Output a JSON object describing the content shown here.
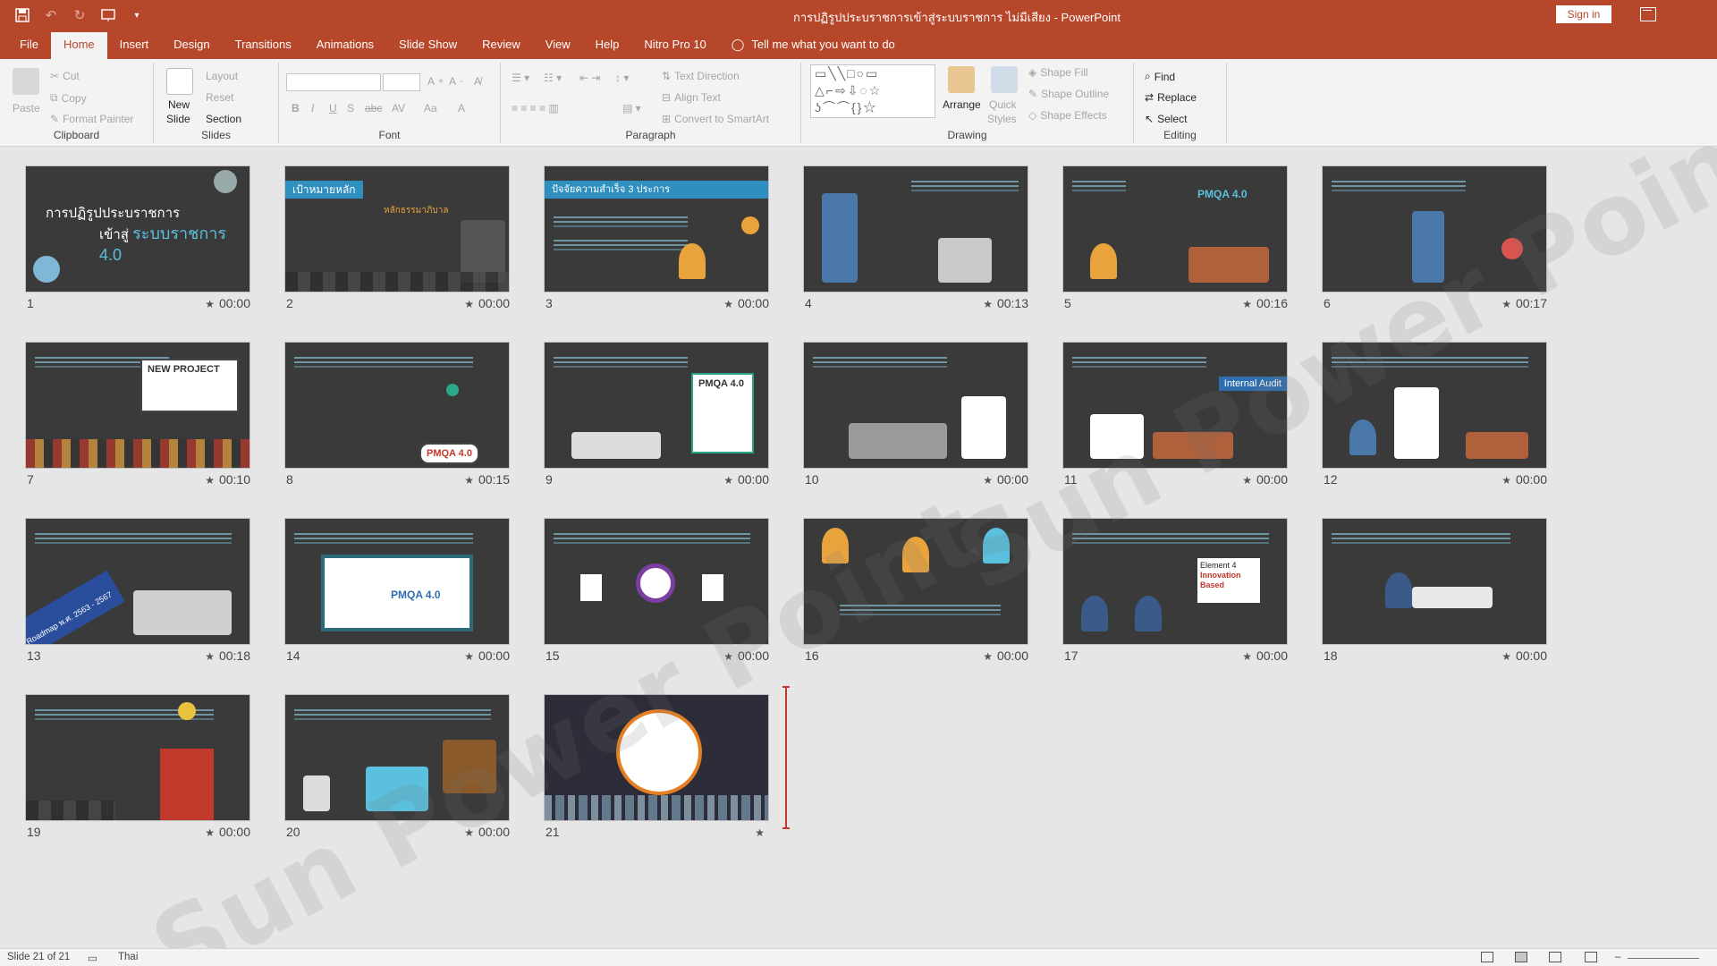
{
  "window": {
    "title": "การปฏิรูปประบราชการเข้าสู่ระบบราชการ ไม่มีเสียง - PowerPoint",
    "signin": "Sign in"
  },
  "tabs": [
    "File",
    "Home",
    "Insert",
    "Design",
    "Transitions",
    "Animations",
    "Slide Show",
    "Review",
    "View",
    "Help",
    "Nitro Pro 10"
  ],
  "tell_me": "Tell me what you want to do",
  "ribbon": {
    "clipboard": {
      "paste": "Paste",
      "cut": "Cut",
      "copy": "Copy",
      "format_painter": "Format Painter",
      "label": "Clipboard"
    },
    "slides": {
      "new_slide_1": "New",
      "new_slide_2": "Slide",
      "layout": "Layout",
      "reset": "Reset",
      "section": "Section",
      "label": "Slides"
    },
    "font": {
      "label": "Font",
      "b": "B",
      "i": "I",
      "u": "U",
      "s": "S",
      "abc": "abc",
      "av": "AV",
      "aa": "Aa",
      "a": "A"
    },
    "paragraph": {
      "text_direction": "Text Direction",
      "align_text": "Align Text",
      "convert_smartart": "Convert to SmartArt",
      "label": "Paragraph"
    },
    "drawing": {
      "arrange": "Arrange",
      "quick_styles_1": "Quick",
      "quick_styles_2": "Styles",
      "shape_fill": "Shape Fill",
      "shape_outline": "Shape Outline",
      "shape_effects": "Shape Effects",
      "label": "Drawing"
    },
    "editing": {
      "find": "Find",
      "replace": "Replace",
      "select": "Select",
      "label": "Editing"
    }
  },
  "slides": [
    {
      "num": "1",
      "time": "00:00"
    },
    {
      "num": "2",
      "time": "00:00"
    },
    {
      "num": "3",
      "time": "00:00"
    },
    {
      "num": "4",
      "time": "00:13"
    },
    {
      "num": "5",
      "time": "00:16"
    },
    {
      "num": "6",
      "time": "00:17"
    },
    {
      "num": "7",
      "time": "00:10"
    },
    {
      "num": "8",
      "time": "00:15"
    },
    {
      "num": "9",
      "time": "00:00"
    },
    {
      "num": "10",
      "time": "00:00"
    },
    {
      "num": "11",
      "time": "00:00"
    },
    {
      "num": "12",
      "time": "00:00"
    },
    {
      "num": "13",
      "time": "00:18"
    },
    {
      "num": "14",
      "time": "00:00"
    },
    {
      "num": "15",
      "time": "00:00"
    },
    {
      "num": "16",
      "time": "00:00"
    },
    {
      "num": "17",
      "time": "00:00"
    },
    {
      "num": "18",
      "time": "00:00"
    },
    {
      "num": "19",
      "time": "00:00"
    },
    {
      "num": "20",
      "time": "00:00"
    },
    {
      "num": "21",
      "time": ""
    }
  ],
  "slide_text": {
    "s1_line1": "การปฏิรูปประบราชการ",
    "s1_line2": "เข้าสู่",
    "s1_accent": "ระบบราชการ 4.0",
    "s2_banner": "เป้าหมายหลัก",
    "s2_accent": "หลักธรรมาภิบาล",
    "s3_banner": "ปัจจัยความสำเร็จ 3 ประการ",
    "s5_label": "PMQA 4.0",
    "s7_label": "NEW PROJECT",
    "s8_label": "PMQA 4.0",
    "s9_label": "PMQA 4.0",
    "s11_label": "Internal Audit",
    "s13_label": "Roadmap พ.ศ. 2563 - 2567",
    "s14_label": "PMQA 4.0",
    "s17_l1": "Element 4",
    "s17_l2": "Innovation",
    "s17_l3": "Based"
  },
  "watermark": "Sun Power Point",
  "status": {
    "slide_of": "Slide 21 of 21",
    "language": "Thai"
  },
  "colors": {
    "accent": "#b7472a",
    "slide_bg": "#3a3a3a",
    "blue": "#2f8fbf"
  }
}
